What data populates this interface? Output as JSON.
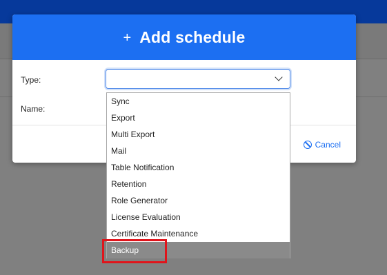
{
  "modal": {
    "title": "Add schedule",
    "plus_icon": "+",
    "icon_names": {
      "add": "plus-icon",
      "cancel": "ban-icon",
      "dropdown": "chevron-down-icon"
    }
  },
  "form": {
    "type_label": "Type:",
    "name_label": "Name:",
    "type_value": ""
  },
  "dropdown": {
    "options": [
      "Sync",
      "Export",
      "Multi Export",
      "Mail",
      "Table Notification",
      "Retention",
      "Role Generator",
      "License Evaluation",
      "Certificate Maintenance",
      "Backup"
    ],
    "highlighted": "Backup"
  },
  "footer": {
    "cancel_label": "Cancel"
  },
  "colors": {
    "header_blue": "#1c6ff2",
    "app_topbar": "#06399b",
    "annotation_red": "#e0141b"
  }
}
